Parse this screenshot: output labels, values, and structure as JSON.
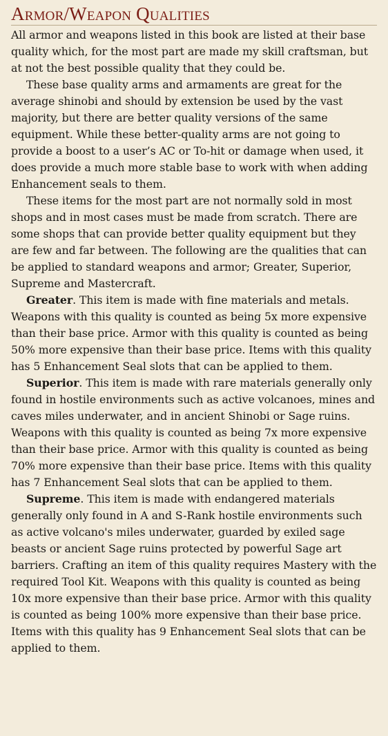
{
  "section": {
    "title": "Armor/Weapon Qualities"
  },
  "paragraphs": {
    "intro": "All armor and weapons listed in this book are listed at their base quality which, for the most part are made my skill craftsman, but at not the best possible quality that they could be.",
    "base": "These base quality arms and armaments are great for the average shinobi and should by extension be used by the vast majority, but there are better quality versions of the same equipment. While these better-quality arms are not going to provide a boost to a user’s AC or To-hit or damage when used, it does provide a much more stable base to work with when adding Enhancement seals to them.",
    "shops": "These items for the most part are not normally sold in most shops and in most cases must be made from scratch. There are some shops that can provide better quality equipment but they are few and far between. The following are the qualities that can be applied to standard weapons and armor; Greater, Superior, Supreme and Mastercraft."
  },
  "qualities": {
    "greater": {
      "name": "Greater",
      "text": ". This item is made with fine materials and metals. Weapons with this quality is counted as being 5x more expensive than their base price. Armor with this quality is counted as being 50% more expensive than their base price. Items with this quality has 5 Enhancement Seal slots that can be applied to them."
    },
    "superior": {
      "name": "Superior",
      "text": ". This item is made with rare materials generally only found in hostile environments such as active volcanoes, mines and caves miles underwater, and in ancient Shinobi or Sage ruins.  Weapons with this quality is counted as being 7x more expensive than their base price. Armor with this quality is counted as being 70% more expensive than their base price. Items with this quality has 7 Enhancement Seal slots that can be applied to them."
    },
    "supreme": {
      "name": "Supreme",
      "text": ". This item is made with endangered materials generally only found in A and S-Rank hostile environments such as active volcano's miles underwater, guarded by exiled sage beasts or ancient Sage ruins protected by powerful Sage art barriers. Crafting an item of this quality requires Mastery with the required Tool Kit. Weapons with this quality is counted as being 10x more expensive than their base price. Armor with this quality is counted as being 100% more expensive than their base price. Items with this quality has 9 Enhancement Seal slots that can be applied to them."
    }
  },
  "colors": {
    "background": "#f3ecdc",
    "heading": "#7a1c14",
    "text": "#1c1a17"
  }
}
